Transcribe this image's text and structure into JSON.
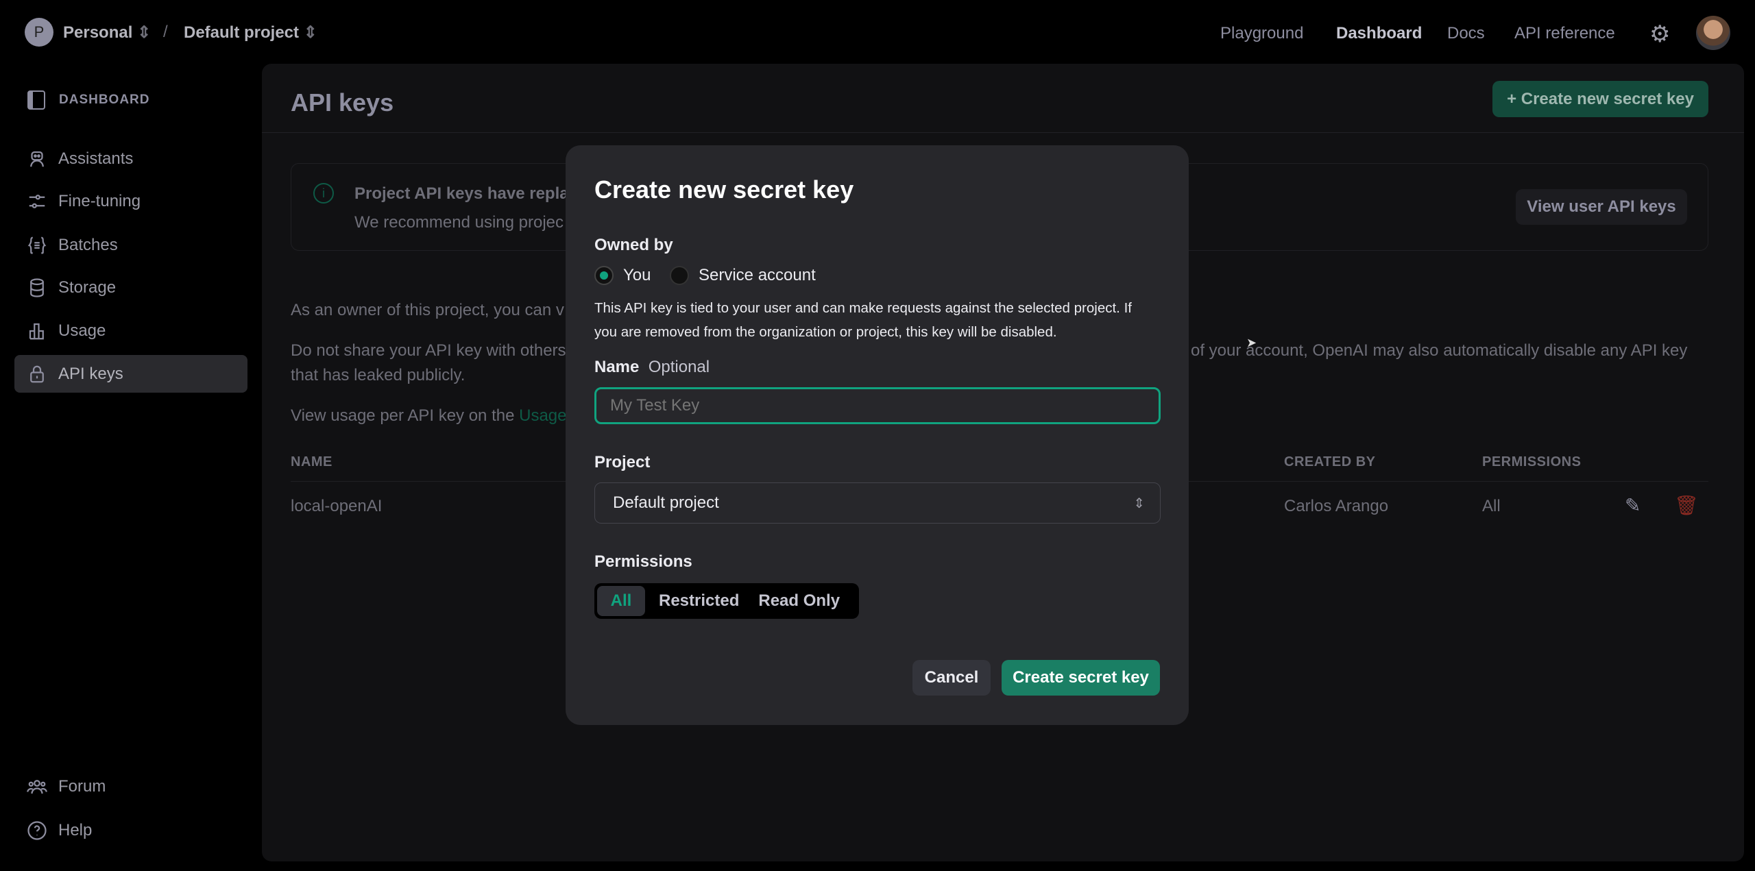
{
  "topbar": {
    "org_initial": "P",
    "org": "Personal",
    "separator": "/",
    "project": "Default project",
    "nav": [
      "Playground",
      "Dashboard",
      "Docs",
      "API reference"
    ],
    "active_nav": "Dashboard"
  },
  "sidebar": {
    "section": "DASHBOARD",
    "items": [
      {
        "label": "Assistants",
        "icon": "robot-icon"
      },
      {
        "label": "Fine-tuning",
        "icon": "sliders-icon"
      },
      {
        "label": "Batches",
        "icon": "braces-icon"
      },
      {
        "label": "Storage",
        "icon": "database-icon"
      },
      {
        "label": "Usage",
        "icon": "bar-chart-icon"
      },
      {
        "label": "API keys",
        "icon": "lock-icon",
        "active": true
      }
    ],
    "footer": [
      {
        "label": "Forum",
        "icon": "users-icon"
      },
      {
        "label": "Help",
        "icon": "help-icon"
      }
    ]
  },
  "main": {
    "title": "API keys",
    "create_button": "+ Create new secret key",
    "banner": {
      "title": "Project API keys have replac",
      "body": "We recommend using projec",
      "button": "View user API keys"
    },
    "p1": "As an owner of this project, you can v",
    "p2a": "Do not share your API key with others",
    "p2b": "of your account, OpenAI may also automatically disable any API key",
    "p2c": "that has leaked publicly.",
    "p3": "View usage per API key on the ",
    "p3_link": "Usage",
    "table": {
      "headers": [
        "NAME",
        "CREATED BY",
        "PERMISSIONS"
      ],
      "rows": [
        {
          "name": "local-openAI",
          "created_by": "Carlos Arango",
          "permissions": "All"
        }
      ]
    }
  },
  "modal": {
    "title": "Create new secret key",
    "owned_by_label": "Owned by",
    "owner_options": [
      "You",
      "Service account"
    ],
    "owner_selected": "You",
    "description_1": "This API key is tied to your user and can make requests against the selected project. If",
    "description_2": "you are removed from the organization or project, this key will be disabled.",
    "name_label": "Name",
    "name_optional": "Optional",
    "name_value": "",
    "name_placeholder": "My Test Key",
    "project_label": "Project",
    "project_value": "Default project",
    "permissions_label": "Permissions",
    "permission_options": [
      "All",
      "Restricted",
      "Read Only"
    ],
    "permission_selected": "All",
    "cancel": "Cancel",
    "submit": "Create secret key"
  },
  "colors": {
    "accent": "#10a37f",
    "button_green": "#1a7f64",
    "danger": "#d03d2e"
  }
}
